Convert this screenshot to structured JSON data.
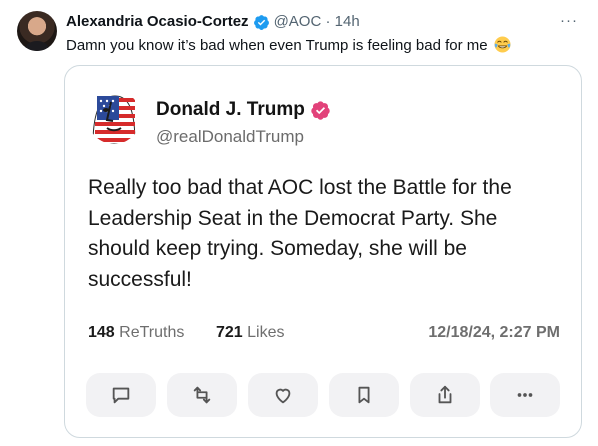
{
  "post": {
    "author_name": "Alexandria Ocasio-Cortez",
    "handle": "@AOC",
    "separator": "·",
    "time": "14h",
    "more_label": "···",
    "text": "Damn you know it’s bad when even Trump is feeling bad for me",
    "emoji": "face-with-tears-of-joy-icon",
    "colors": {
      "verified": "#1d9bf0",
      "text": "#0f1419",
      "secondary": "#536471"
    }
  },
  "embedded": {
    "author_name": "Donald J. Trump",
    "handle": "@realDonaldTrump",
    "badge_color": "#e2427a",
    "body": "Really too bad that AOC lost the Battle for the Leadership Seat in the Democrat Party. She should keep trying. Someday, she will be successful!",
    "retruths_count": "148",
    "retruths_label": "ReTruths",
    "likes_count": "721",
    "likes_label": "Likes",
    "timestamp": "12/18/24, 2:27 PM",
    "actions": [
      "reply-icon",
      "retruth-icon",
      "like-icon",
      "bookmark-icon",
      "share-icon",
      "more-icon"
    ]
  }
}
